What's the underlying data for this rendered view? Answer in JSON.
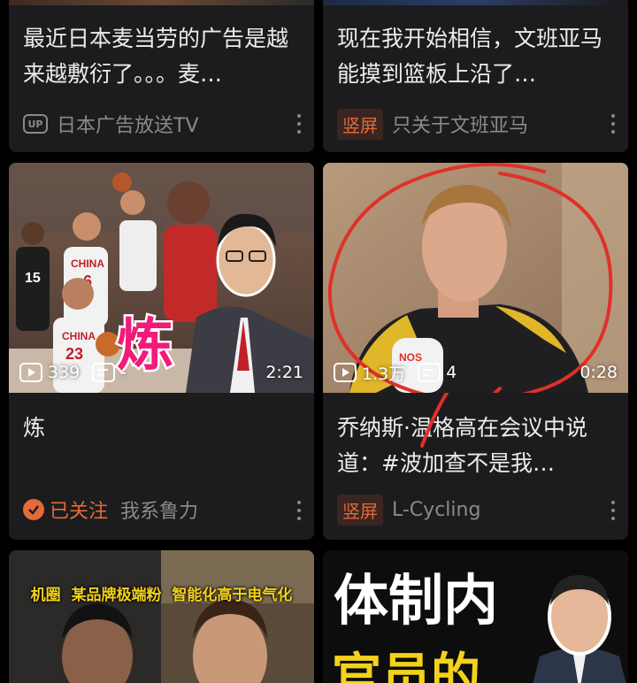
{
  "cards": [
    {
      "title": "最近日本麦当劳的广告是越来越敷衍了。。。麦…",
      "badge": "UP",
      "author": "日本广告放送TV"
    },
    {
      "title": "现在我开始相信，文班亚马能摸到篮板上沿了…",
      "tag": "竖屏",
      "author": "只关于文班亚马"
    },
    {
      "title": "炼",
      "overlay_text": "炼",
      "jersey_team": "CHINA",
      "jersey_numbers": [
        "6",
        "23",
        "15"
      ],
      "views": "339",
      "danmaku": "-",
      "duration": "2:21",
      "followed_label": "已关注",
      "author": "我系鲁力"
    },
    {
      "title": "乔纳斯·温格高在会议中说道：#波加查不是我…",
      "mic_label": "NOS",
      "views": "1.3万",
      "danmaku": "4",
      "duration": "0:28",
      "tag": "竖屏",
      "author": "L-Cycling"
    },
    {
      "caption": "机圈  某品牌极端粉  智能化高于电气化"
    },
    {
      "big_text_1": "体制内",
      "big_text_2": "官员的"
    }
  ],
  "colors": {
    "accent_orange": "#e46a3a",
    "card_bg": "#1c1c1e",
    "page_bg": "#000000",
    "annotation_red": "#e0302a",
    "yellow_text": "#f3d21a"
  }
}
